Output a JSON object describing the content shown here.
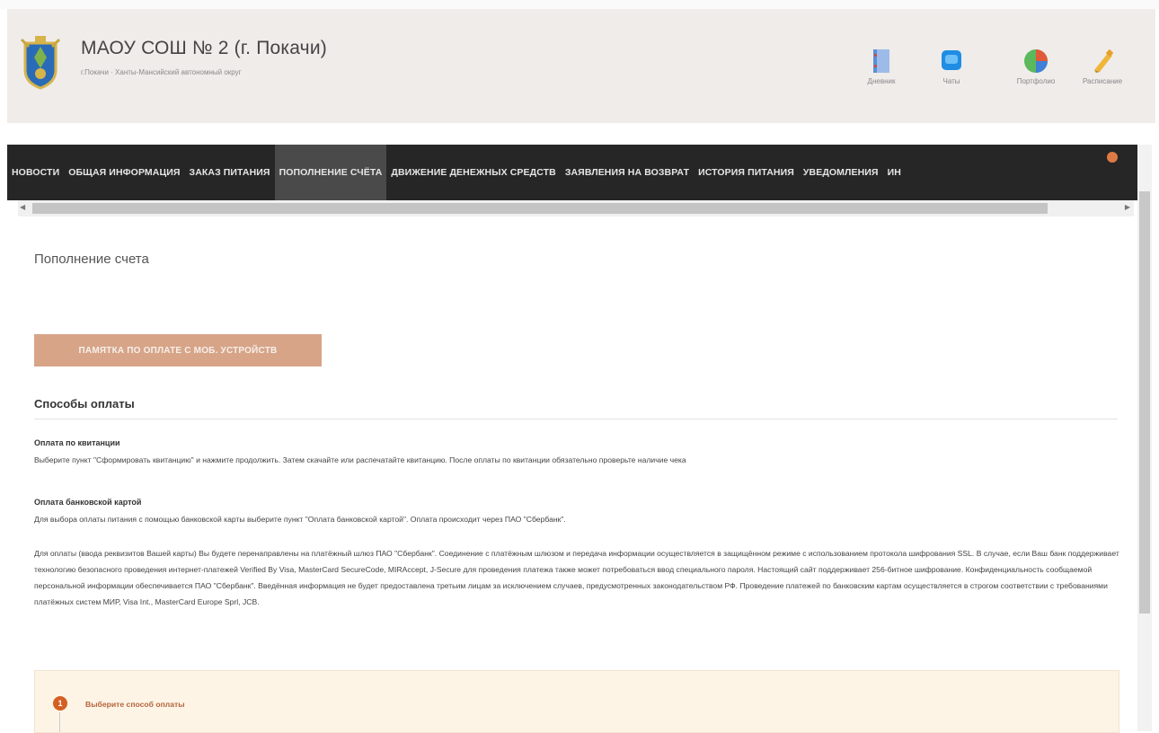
{
  "header": {
    "school_name": "МАОУ СОШ № 2 (г. Покачи)",
    "location": "г.Покачи · Ханты-Мансийский автономный округ",
    "icons": [
      {
        "label": "Дневник",
        "icon": "diary-icon"
      },
      {
        "label": "Чаты",
        "icon": "chat-icon"
      },
      {
        "label": "Портфолио",
        "icon": "portfolio-icon"
      },
      {
        "label": "Расписание",
        "icon": "schedule-icon"
      }
    ]
  },
  "nav": {
    "items": [
      "НОВОСТИ",
      "ОБЩАЯ ИНФОРМАЦИЯ",
      "ЗАКАЗ ПИТАНИЯ",
      "ПОПОЛНЕНИЕ СЧЁТА",
      "ДВИЖЕНИЕ ДЕНЕЖНЫХ СРЕДСТВ",
      "ЗАЯВЛЕНИЯ НА ВОЗВРАТ",
      "ИСТОРИЯ ПИТАНИЯ",
      "УВЕДОМЛЕНИЯ",
      "ИН"
    ],
    "active": "ПОПОЛНЕНИЕ СЧЁТА",
    "badge_color": "#e07a45"
  },
  "main": {
    "page_title": "Пополнение счета",
    "memo_button": "ПАМЯТКА ПО ОПЛАТЕ С МОБ. УСТРОЙСТВ",
    "payment_methods_title": "Способы оплаты",
    "receipt_title": "Оплата по квитанции",
    "receipt_text": "Выберите пункт \"Сформировать квитанцию\" и нажмите продолжить. Затем скачайте или распечатайте квитанцию. После оплаты по квитанции обязательно проверьте наличие чека",
    "card_title": "Оплата банковской картой",
    "card_text": "Для выбора оплаты питания с помощью банковской карты выберите пункт \"Оплата банковской картой\". Оплата происходит через ПАО \"Сбербанк\".",
    "security_text": "Для оплаты (ввода реквизитов Вашей карты) Вы будете перенаправлены на платёжный шлюз ПАО \"Сбербанк\". Соединение с платёжным шлюзом и передача информации осуществляется в защищённом режиме с использованием протокола шифрования SSL. В случае, если Ваш банк поддерживает технологию безопасного проведения интернет-платежей Verified By Visa, MasterCard SecureCode, MIRAccept, J-Secure для проведения платежа также может потребоваться ввод специального пароля. Настоящий сайт поддерживает 256-битное шифрование. Конфиденциальность сообщаемой персональной информации обеспечивается ПАО \"Сбербанк\". Введённая информация не будет предоставлена третьим лицам за исключением случаев, предусмотренных законодательством РФ. Проведение платежей по банковским картам осуществляется в строгом соответствии с требованиями платёжных систем МИР, Visa Int., MasterCard Europe Sprl, JCB.",
    "step_number": "1",
    "step_label": "Выберите способ оплаты"
  },
  "colors": {
    "nav_bg": "#262626",
    "nav_active": "#4a4a4a",
    "memo_button_bg": "#d7a488",
    "step_accent": "#d45f23",
    "steps_bg": "#fdf4e6"
  }
}
